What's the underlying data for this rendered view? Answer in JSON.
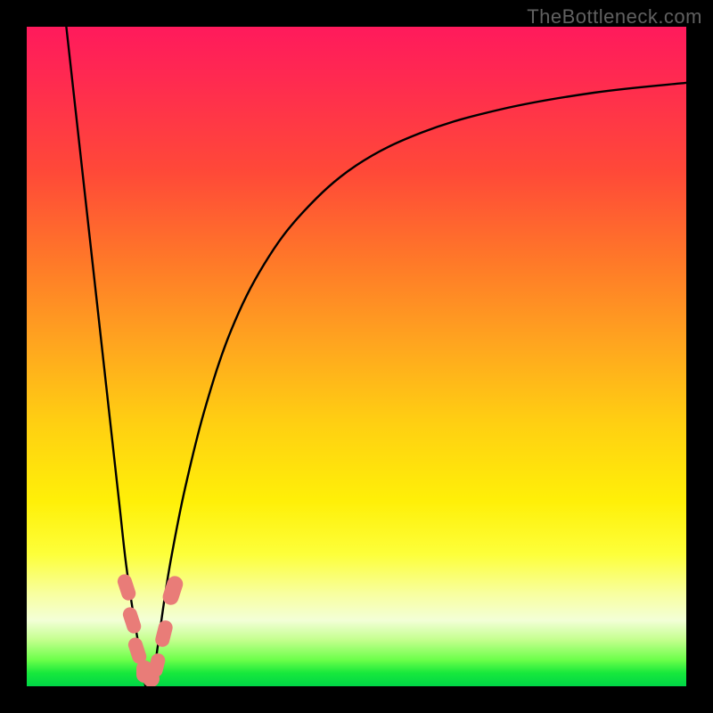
{
  "watermark": "TheBottleneck.com",
  "colors": {
    "curve_stroke": "#000000",
    "marker_fill": "#e97c78",
    "frame": "#000000"
  },
  "chart_data": {
    "type": "line",
    "title": "",
    "xlabel": "",
    "ylabel": "",
    "xlim": [
      0,
      100
    ],
    "ylim": [
      0,
      100
    ],
    "series": [
      {
        "name": "left-branch",
        "x": [
          6,
          8,
          10,
          12,
          14,
          15,
          16,
          17,
          18
        ],
        "y": [
          100,
          82,
          64,
          46,
          28,
          19,
          12,
          6,
          0
        ]
      },
      {
        "name": "right-branch",
        "x": [
          19,
          20,
          21,
          22,
          24,
          27,
          31,
          36,
          42,
          50,
          60,
          72,
          86,
          100
        ],
        "y": [
          0,
          7,
          14,
          20,
          30,
          42,
          54,
          64,
          72,
          79,
          84,
          87.5,
          90,
          91.5
        ]
      }
    ],
    "markers": {
      "name": "bottom-cluster",
      "description": "rounded salmon capsule markers clustered near curve minimum",
      "items": [
        {
          "cx": 15.2,
          "cy": 15.0,
          "w": 2.2,
          "h": 4.0,
          "angle": -18
        },
        {
          "cx": 16.0,
          "cy": 10.0,
          "w": 2.2,
          "h": 4.0,
          "angle": -18
        },
        {
          "cx": 16.8,
          "cy": 5.4,
          "w": 2.2,
          "h": 4.0,
          "angle": -18
        },
        {
          "cx": 17.8,
          "cy": 2.2,
          "w": 2.4,
          "h": 3.4,
          "angle": 0
        },
        {
          "cx": 18.8,
          "cy": 1.2,
          "w": 2.6,
          "h": 2.6,
          "angle": 0
        },
        {
          "cx": 19.8,
          "cy": 3.2,
          "w": 2.2,
          "h": 3.6,
          "angle": 14
        },
        {
          "cx": 20.8,
          "cy": 8.0,
          "w": 2.2,
          "h": 4.0,
          "angle": 14
        },
        {
          "cx": 22.2,
          "cy": 14.5,
          "w": 2.4,
          "h": 4.4,
          "angle": 18
        }
      ]
    }
  }
}
